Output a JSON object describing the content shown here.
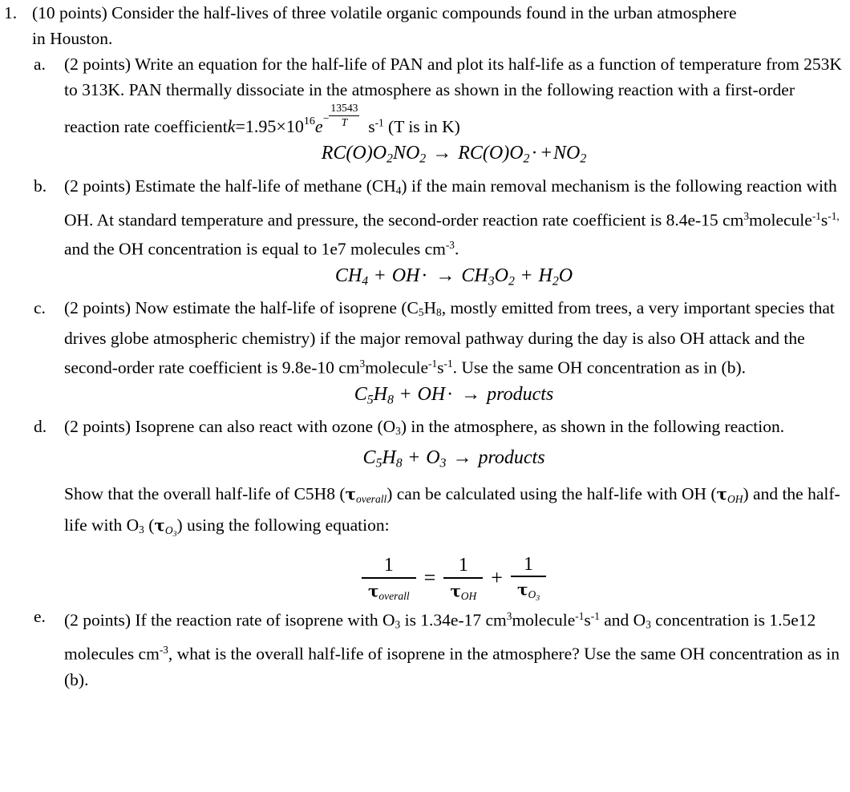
{
  "question": {
    "number": "1.",
    "points": "(10 points)",
    "intro_line1": "(10 points) Consider the half-lives of three volatile organic compounds found in the urban atmosphere",
    "intro_line2": "in Houston."
  },
  "parts": [
    {
      "marker": "a.",
      "points": "(2 points)",
      "text_before_math": "(2 points) Write an equation for the half-life of PAN and plot its half-life as a function of temperature from 253K to 313K. PAN thermally dissociate in the atmosphere as shown in the following reaction with a first-order reaction rate coefficient",
      "math": {
        "k_symbol": "k",
        "equals": "=",
        "coefficient": "1.95",
        "times": "×",
        "base": "10",
        "exponent": "16",
        "e_symbol": "e",
        "minus": "−",
        "ea_over_r": "13543",
        "temperature_symbol": "T"
      },
      "units": "s",
      "units_exponent": "-1",
      "text_after_math": "(T is in K)",
      "equation": {
        "lhs": "RC(O)O",
        "lhs_sub1": "2",
        "lhs_mid": "NO",
        "lhs_sub2": "2",
        "arrow": "→",
        "rhs": "RC(O)O",
        "rhs_sub1": "2",
        "radical": "·",
        "plus": "+",
        "rhs_product": "NO",
        "rhs_sub2": "2"
      }
    },
    {
      "marker": "b.",
      "points": "(2 points)",
      "text": "(2 points) Estimate the half-life of methane (CH4) if the main removal mechanism is the following reaction with OH. At standard temperature and pressure, the second-order reaction rate coefficient is 8.4e-15 cm3molecule-1s-1, and the OH concentration is equal to 1e7 molecules cm-3.",
      "tokens": {
        "t1": "(2 points) Estimate the half-life of methane (CH",
        "sub_4": "4",
        "t2": ") if the main removal mechanism is the following reaction with OH. At standard temperature and pressure, the second-order reaction rate coefficient is 8.4e-15 cm",
        "sup_3": "3",
        "t3": "molecule",
        "sup_m1a": "-1",
        "t4": "s",
        "sup_m1b": "-1,",
        "t5": " and the OH concentration is equal to 1e7 molecules cm",
        "sup_m3": "-3",
        "t6": "."
      },
      "equation": {
        "r1": "CH",
        "r1_sub": "4",
        "plus": "+",
        "r2": "OH",
        "radical": "·",
        "arrow": "→",
        "p1": "CH",
        "p1_sub": "3",
        "p1_o": "O",
        "p1_osub": "2",
        "plus2": "+",
        "p2": "H",
        "p2_sub": "2",
        "p2_o": "O"
      }
    },
    {
      "marker": "c.",
      "points": "(2 points)",
      "text": "(2 points) Now estimate the half-life of isoprene (C5H8, mostly emitted from trees, a very important species that drives globe atmospheric chemistry) if the major removal pathway during the day is also OH attack and the second-order rate coefficient is 9.8e-10 cm3molecule-1s-1. Use the same OH concentration as in (b).",
      "tokens": {
        "t1": "(2 points) Now estimate the half-life of isoprene (C",
        "sub_5": "5",
        "t2": "H",
        "sub_8": "8",
        "t3": ", mostly emitted from trees, a very important species that drives globe atmospheric chemistry) if the major removal pathway during the day is also OH attack and the second-order rate coefficient is 9.8e-10 cm",
        "sup_3": "3",
        "t4": "molecule",
        "sup_m1a": "-1",
        "t5": "s",
        "sup_m1b": "-1",
        "t6": ". Use the same OH concentration as in (b)."
      },
      "equation": {
        "r1": "C",
        "r1_sub": "5",
        "r1b": "H",
        "r1b_sub": "8",
        "plus": "+",
        "r2": "OH",
        "radical": "·",
        "arrow": "→",
        "products": "products"
      }
    },
    {
      "marker": "d.",
      "points": "(2 points)",
      "text": "(2 points) Isoprene can also react with ozone (O3) in the atmosphere, as shown in the following reaction.",
      "tokens": {
        "t1": "(2 points) Isoprene can also react with ozone (O",
        "sub_3": "3",
        "t2": ") in the atmosphere, as shown in the following reaction."
      },
      "equation": {
        "r1": "C",
        "r1_sub": "5",
        "r1b": "H",
        "r1b_sub": "8",
        "plus": "+",
        "r2": "O",
        "r2_sub": "3",
        "arrow": "→",
        "products": "products"
      },
      "show_text": {
        "t1": "Show that the overall half-life of C5H8 (",
        "tau1": "τ",
        "tau1_sub": "overall",
        "t2": ") can be calculated using the half-life with OH (",
        "tau2": "τ",
        "tau2_sub": "OH",
        "t3": ") and the half-life with O",
        "sub_3": "3",
        "t4": " (",
        "tau3": "τ",
        "tau3_sub": "O",
        "tau3_subsub": "3",
        "t5": ") using the following equation:"
      },
      "fraction_equation": {
        "numer1": "1",
        "denom1_tau": "τ",
        "denom1_sub": "overall",
        "equals": "=",
        "numer2": "1",
        "denom2_tau": "τ",
        "denom2_sub": "OH",
        "plus": "+",
        "numer3": "1",
        "denom3_tau": "τ",
        "denom3_sub": "O",
        "denom3_subsub": "3"
      }
    },
    {
      "marker": "e.",
      "points": "(2 points)",
      "text": "(2 points) If the reaction rate of isoprene with O3 is 1.34e-17 cm3molecule-1s-1 and O3 concentration is 1.5e12 molecules cm-3, what is the overall half-life of isoprene in the atmosphere? Use the same OH concentration as in (b).",
      "tokens": {
        "t1": "(2 points) If the reaction rate of isoprene with O",
        "sub_3a": "3",
        "t2": " is 1.34e-17 cm",
        "sup_3": "3",
        "t3": "molecule",
        "sup_m1a": "-1",
        "t4": "s",
        "sup_m1b": "-1",
        "t5": " and O",
        "sub_3b": "3",
        "t6": " concentration is 1.5e12 molecules cm",
        "sup_m3": "-3",
        "t7": ", what is the overall half-life of isoprene in the atmosphere? Use the same OH concentration as in (b)."
      }
    }
  ]
}
